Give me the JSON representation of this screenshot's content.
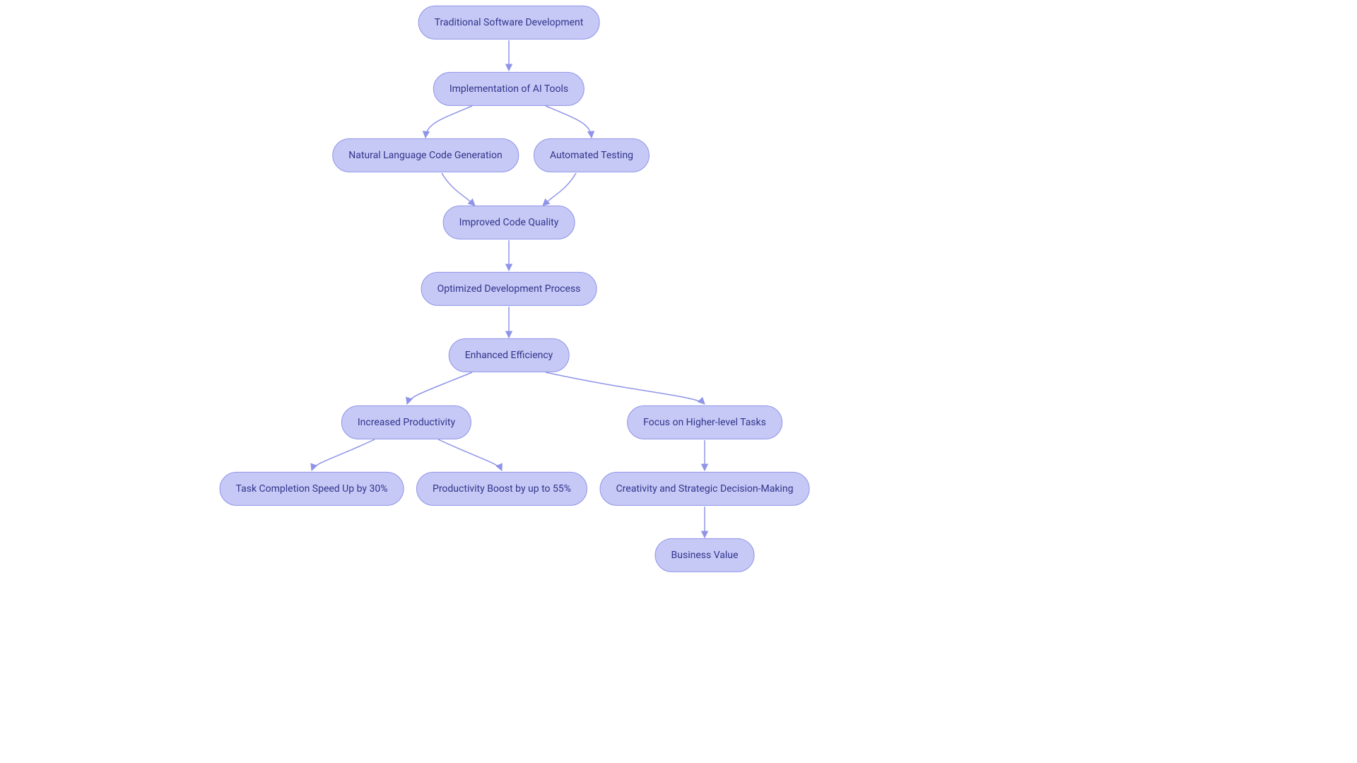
{
  "colors": {
    "node_fill": "#c6c9f5",
    "node_border": "#8f94e8",
    "node_text": "#31348c",
    "edge": "#8f94e8",
    "bg": "#ffffff"
  },
  "nodes": {
    "n1": {
      "label": "Traditional Software Development"
    },
    "n2": {
      "label": "Implementation of AI Tools"
    },
    "n3": {
      "label": "Natural Language Code Generation"
    },
    "n4": {
      "label": "Automated Testing"
    },
    "n5": {
      "label": "Improved Code Quality"
    },
    "n6": {
      "label": "Optimized Development Process"
    },
    "n7": {
      "label": "Enhanced Efficiency"
    },
    "n8": {
      "label": "Increased Productivity"
    },
    "n9": {
      "label": "Focus on Higher-level Tasks"
    },
    "n10": {
      "label": "Task Completion Speed Up by 30%"
    },
    "n11": {
      "label": "Productivity Boost by up to 55%"
    },
    "n12": {
      "label": "Creativity and Strategic Decision-Making"
    },
    "n13": {
      "label": "Business Value"
    }
  }
}
